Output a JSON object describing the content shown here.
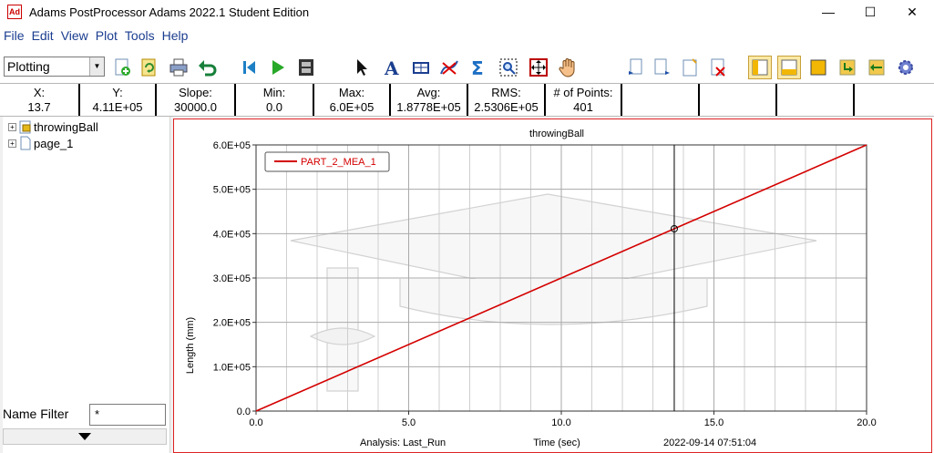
{
  "window": {
    "icon_text": "Ad",
    "title": "Adams  PostProcessor Adams 2022.1 Student Edition",
    "minimize": "—",
    "maximize": "☐",
    "close": "✕"
  },
  "menu": [
    "File",
    "Edit",
    "View",
    "Plot",
    "Tools",
    "Help"
  ],
  "toolbar": {
    "mode": "Plotting",
    "icons": [
      "new-page-icon",
      "reload-icon",
      "print-icon",
      "undo-icon",
      "rewind-icon",
      "play-icon",
      "animation-film-icon",
      "select-arrow-icon",
      "text-a-icon",
      "table-icon",
      "curve-edit-icon",
      "sigma-math-icon",
      "zoom-box-icon",
      "fit-icon",
      "pan-hand-icon",
      "previous-page-icon",
      "next-page-icon",
      "new-page-icon",
      "delete-page-icon",
      "layout-left-icon",
      "layout-bottom-icon",
      "layout-full-icon",
      "export-icon",
      "import-icon",
      "settings-gear-icon"
    ]
  },
  "info": {
    "x_label": "X:",
    "x_value": "13.7",
    "y_label": "Y:",
    "y_value": "4.11E+05",
    "slope_label": "Slope:",
    "slope_value": "30000.0",
    "min_label": "Min:",
    "min_value": "0.0",
    "max_label": "Max:",
    "max_value": "6.0E+05",
    "avg_label": "Avg:",
    "avg_value": "1.8778E+05",
    "rms_label": "RMS:",
    "rms_value": "2.5306E+05",
    "points_label": "# of Points:",
    "points_value": "401"
  },
  "tree": {
    "items": [
      {
        "label": "throwingBall",
        "icon": "model-folder-icon"
      },
      {
        "label": "page_1",
        "icon": "page-icon"
      }
    ],
    "filter_label": "Name Filter",
    "filter_value": "*"
  },
  "chart_data": {
    "type": "line",
    "title": "throwingBall",
    "xlabel": "Time (sec)",
    "ylabel": "Length (mm)",
    "xlim": [
      0,
      20
    ],
    "ylim": [
      0,
      600000
    ],
    "x_ticks": [
      "0.0",
      "5.0",
      "10.0",
      "15.0",
      "20.0"
    ],
    "y_ticks": [
      "0.0",
      "1.0E+05",
      "2.0E+05",
      "3.0E+05",
      "4.0E+05",
      "5.0E+05",
      "6.0E+05"
    ],
    "grid": true,
    "legend_position": "top-left",
    "series": [
      {
        "name": "PART_2_MEA_1",
        "color": "#d40000",
        "x": [
          0,
          20
        ],
        "y": [
          0,
          600000
        ]
      }
    ],
    "cursor": {
      "x": 13.7,
      "y": 411000
    },
    "footer": {
      "analysis": "Analysis:  Last_Run",
      "timestamp": "2022-09-14 07:51:04"
    }
  }
}
